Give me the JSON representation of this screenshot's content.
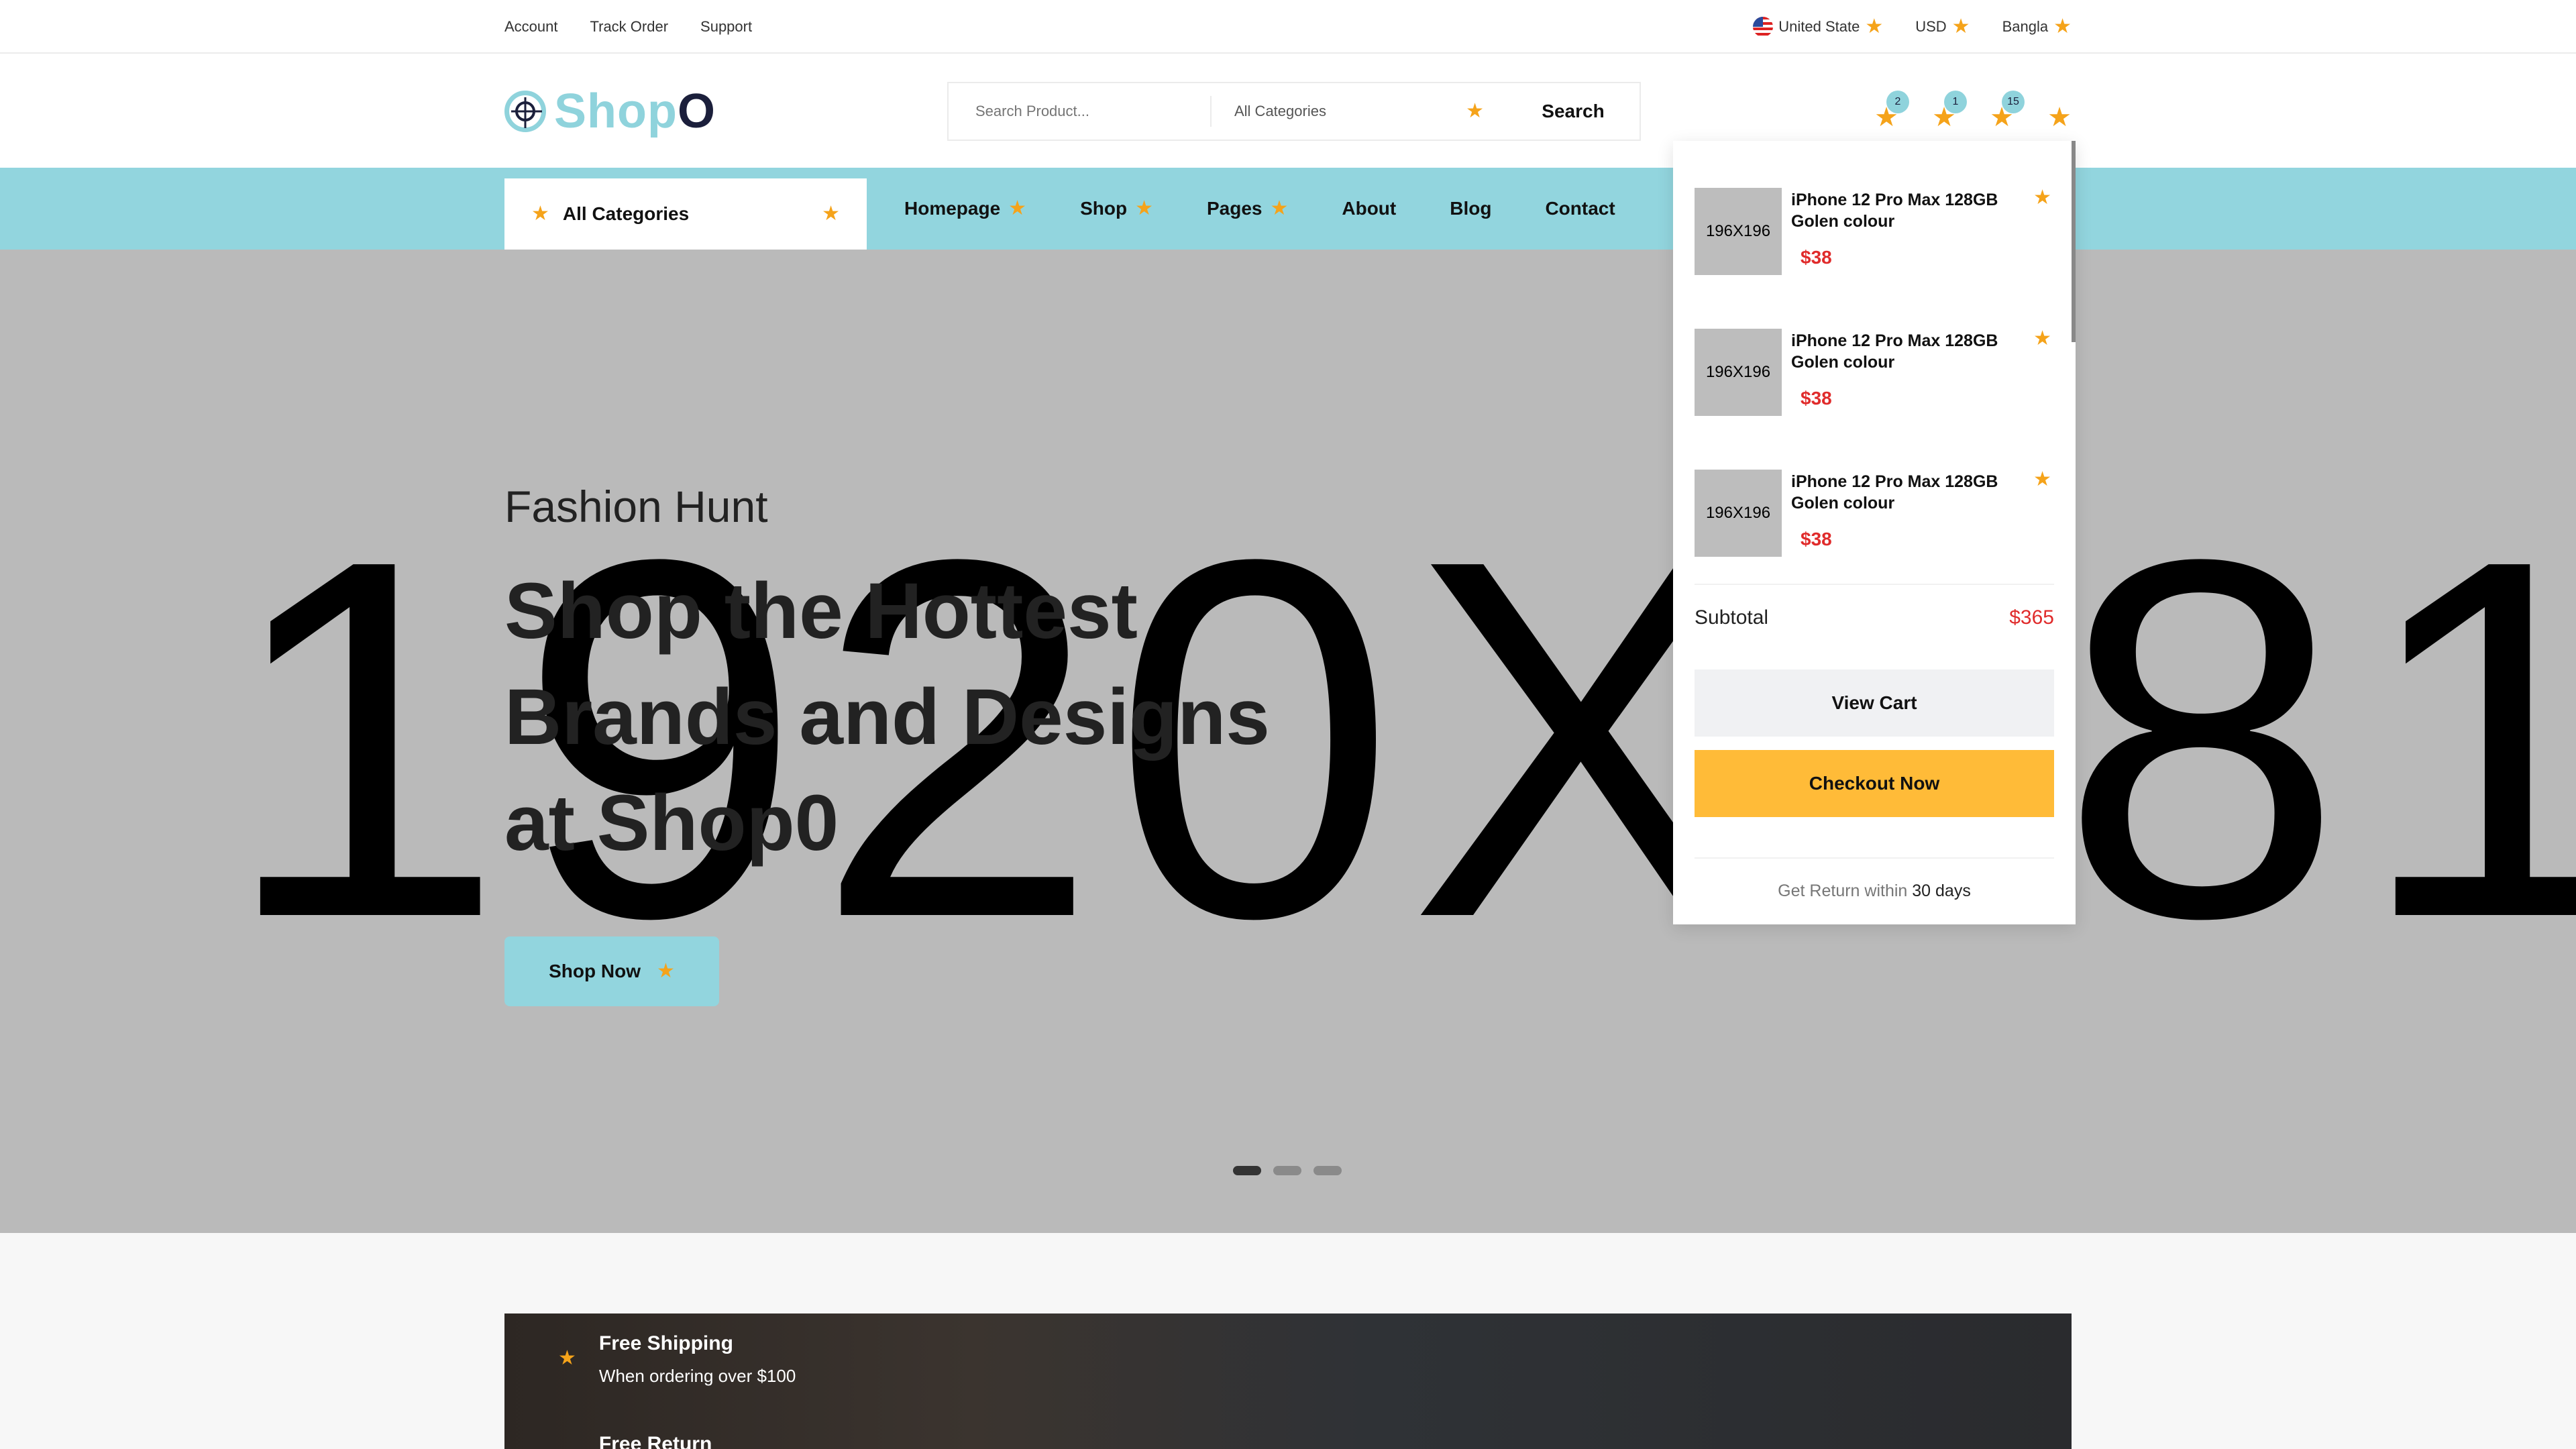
{
  "topbar": {
    "links": [
      "Account",
      "Track Order",
      "Support"
    ],
    "country": "United State",
    "currency": "USD",
    "language": "Bangla"
  },
  "header": {
    "logo_main": "Shop",
    "logo_accent": "O",
    "search_placeholder": "Search Product...",
    "search_category": "All Categories",
    "search_button": "Search",
    "badges": {
      "compare": "2",
      "wishlist": "1",
      "cart": "15"
    }
  },
  "nav": {
    "all_categories": "All Categories",
    "items": [
      "Homepage",
      "Shop",
      "Pages",
      "About",
      "Blog",
      "Contact"
    ]
  },
  "hero": {
    "placeholder": "1920X681",
    "subtitle": "Fashion Hunt",
    "title_lines": [
      "Shop the Hottest",
      "Brands and Designs",
      "at Shop0"
    ],
    "cta": "Shop Now",
    "slides": 3,
    "active_slide": 1
  },
  "cart": {
    "items": [
      {
        "img": "196X196",
        "name": "iPhone 12 Pro Max 128GB Golen colour",
        "price": "$38"
      },
      {
        "img": "196X196",
        "name": "iPhone 12 Pro Max 128GB Golen colour",
        "price": "$38"
      },
      {
        "img": "196X196",
        "name": "iPhone 12 Pro Max 128GB Golen colour",
        "price": "$38"
      }
    ],
    "subtotal_label": "Subtotal",
    "subtotal_value": "$365",
    "view_cart": "View Cart",
    "checkout": "Checkout Now",
    "return_prefix": "Get Return within ",
    "return_days": "30 days"
  },
  "features": [
    {
      "title": "Free Shipping",
      "desc": "When ordering over $100"
    },
    {
      "title": "Free Return",
      "desc": ""
    }
  ],
  "colors": {
    "accent": "#92d5de",
    "star": "#f5a31a",
    "checkout": "#ffbb38",
    "price": "#e02b2b"
  }
}
